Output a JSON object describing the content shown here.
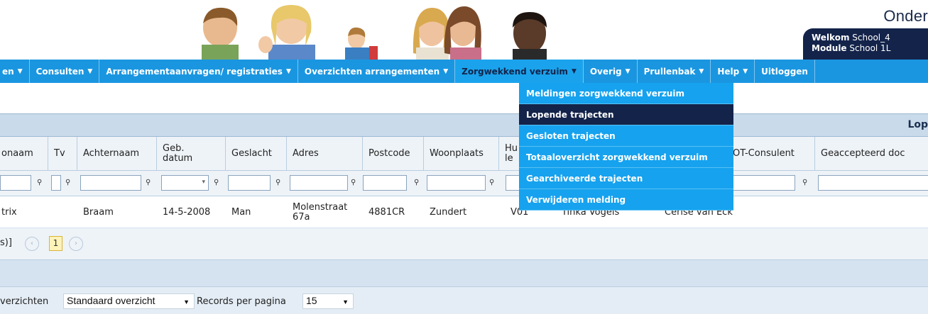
{
  "header": {
    "brand": "Onder",
    "welcome_label": "Welkom",
    "welcome_value": "School_4",
    "module_label": "Module",
    "module_value": "School 1L"
  },
  "nav": [
    {
      "label": "en",
      "arrow": "▼"
    },
    {
      "label": "Consulten",
      "arrow": "▼"
    },
    {
      "label": "Arrangementaanvragen/ registraties",
      "arrow": "▼"
    },
    {
      "label": "Overzichten arrangementen",
      "arrow": "▼"
    },
    {
      "label": "Zorgwekkend verzuim",
      "arrow": "▼"
    },
    {
      "label": "Overig",
      "arrow": "▼"
    },
    {
      "label": "Prullenbak",
      "arrow": "▼"
    },
    {
      "label": "Help",
      "arrow": "▼"
    },
    {
      "label": "Uitloggen",
      "arrow": ""
    }
  ],
  "dropdown": [
    "Meldingen zorgwekkend verzuim",
    "Lopende trajecten",
    "Gesloten trajecten",
    "Totaaloverzicht zorgwekkend verzuim",
    "Gearchiveerde trajecten",
    "Verwijderen melding"
  ],
  "grid": {
    "title": "Lop",
    "columns": [
      "onaam",
      "Tv",
      "Achternaam",
      "Geb. datum",
      "Geslacht",
      "Adres",
      "Postcode",
      "Woonplaats",
      "Hu le",
      "",
      "OT-Consulent",
      "Geaccepteerd doc"
    ],
    "row": [
      "trix",
      "",
      "Braam",
      "14-5-2008",
      "Man",
      "Molenstraat 67a",
      "4881CR",
      "Zundert",
      "V01",
      "Tinka Vogels",
      "Cerise van Eck",
      ""
    ],
    "pager_prefix": "s)]",
    "prev_icon": "‹",
    "next_icon": "›",
    "current_page": "1"
  },
  "footer": {
    "overviews_label": "verzichten",
    "overview_value": "Standaard overzicht",
    "records_label": "Records per pagina",
    "records_value": "15"
  }
}
